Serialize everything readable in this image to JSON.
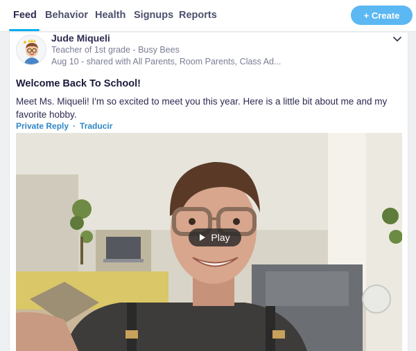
{
  "nav": {
    "tabs": [
      {
        "label": "Feed",
        "active": true
      },
      {
        "label": "Behavior",
        "active": false
      },
      {
        "label": "Health",
        "active": false
      },
      {
        "label": "Signups",
        "active": false
      },
      {
        "label": "Reports",
        "active": false
      }
    ],
    "create_label": "+ Create"
  },
  "post": {
    "author": "Jude Miqueli",
    "role": "Teacher of 1st grade - Busy Bees",
    "meta": "Aug 10 - shared with All Parents, Room Parents, Class Ad...",
    "title": "Welcome Back To School!",
    "body": "Meet Ms. Miqueli! I'm so excited to meet you this year. Here is a little bit about me and my favorite hobby.",
    "actions": {
      "private_reply": "Private Reply",
      "separator": "·",
      "translate": "Traducir"
    },
    "video": {
      "play_label": "Play"
    }
  },
  "colors": {
    "accent": "#00aeef",
    "create_button": "#5cb8f2",
    "link": "#2f87c6",
    "text_dark": "#2c2a50",
    "text_muted": "#7a7d94"
  },
  "icons": [
    "chevron-down-icon",
    "play-icon",
    "avatar-bitmoji"
  ]
}
